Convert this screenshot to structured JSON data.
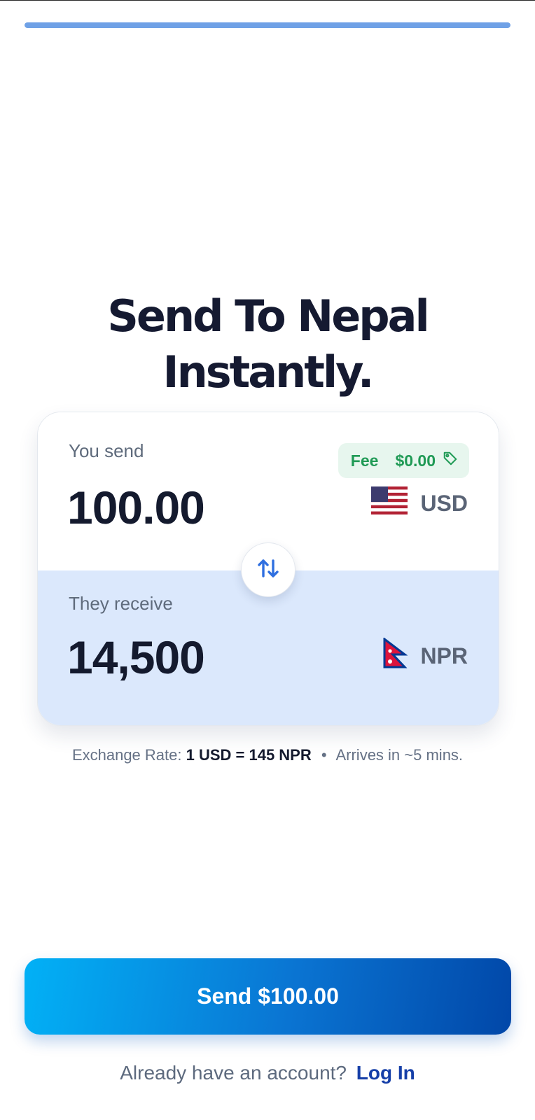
{
  "progress": {
    "fraction": 1.0,
    "color": "#6fa1e6"
  },
  "hero": {
    "line1": "Send To Nepal",
    "line2": "Instantly."
  },
  "converter": {
    "send": {
      "label": "You send",
      "amount": "100.00",
      "currency": "USD",
      "flag_icon": "us-flag-icon"
    },
    "fee": {
      "label": "Fee",
      "value": "$0.00",
      "icon": "tag-icon",
      "color": "#1f9a55"
    },
    "swap_icon": "swap-arrows-icon",
    "receive": {
      "label": "They receive",
      "amount": "14,500",
      "currency": "NPR",
      "flag_icon": "nepal-flag-icon"
    }
  },
  "rate_info": {
    "label": "Exchange Rate:",
    "value": "1 USD = 145 NPR",
    "separator": "•",
    "arrival": "Arrives in ~5 mins."
  },
  "cta": {
    "label": "Send $100.00",
    "gradient_start": "#02b1f6",
    "gradient_end": "#0147a8"
  },
  "login": {
    "prompt": "Already have an account?",
    "link": "Log In",
    "link_color": "#163fa8"
  }
}
